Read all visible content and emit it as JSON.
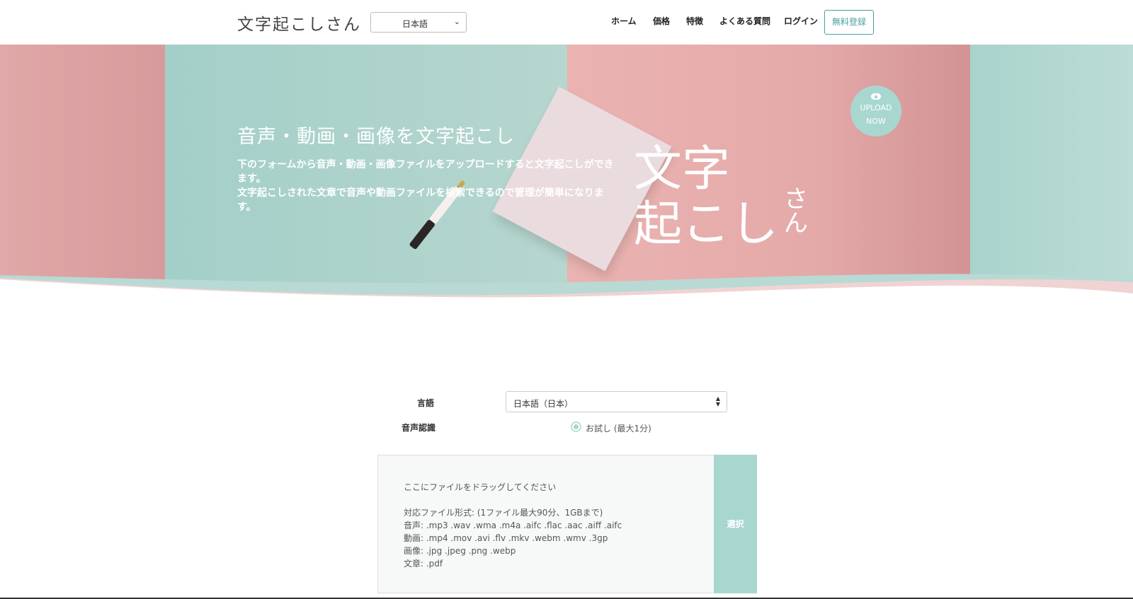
{
  "header": {
    "logo": "文字起こしさん",
    "language_select": "日本語",
    "nav": {
      "home": "ホーム",
      "price": "価格",
      "features": "特徴",
      "faq": "よくある質問",
      "login": "ログイン"
    },
    "signup": "無料登録"
  },
  "hero": {
    "title": "音声・動画・画像を文字起こし",
    "desc_line1": "下のフォームから音声・動画・画像ファイルをアップロードすると文字起こしができます。",
    "desc_line2": "文字起こしされた文章で音声や動画ファイルを検索できるので管理が簡単になります。",
    "big_logo_line1": "文字",
    "big_logo_line2": "起こし",
    "big_logo_suffix": "さん",
    "upload_line1": "UPLOAD",
    "upload_line2": "NOW"
  },
  "form": {
    "language_label": "言語",
    "language_value": "日本語（日本）",
    "speech_label": "音声認識",
    "trial_option": "お試し (最大1分)",
    "dropzone": {
      "drag_text": "ここにファイルをドラッグしてください",
      "formats_title": "対応ファイル形式: (1ファイル最大90分、1GBまで)",
      "audio": "音声: .mp3 .wav .wma .m4a .aifc .flac .aac .aiff .aifc",
      "video": "動画: .mp4 .mov .avi .flv .mkv .webm .wmv .3gp",
      "image": "画像: .jpg .jpeg .png .webp",
      "document": "文章: .pdf"
    },
    "select_button": "選択"
  },
  "colors": {
    "teal": "#a8d7d0",
    "pink": "#e4aaa9",
    "accent": "#4a9fa0"
  }
}
